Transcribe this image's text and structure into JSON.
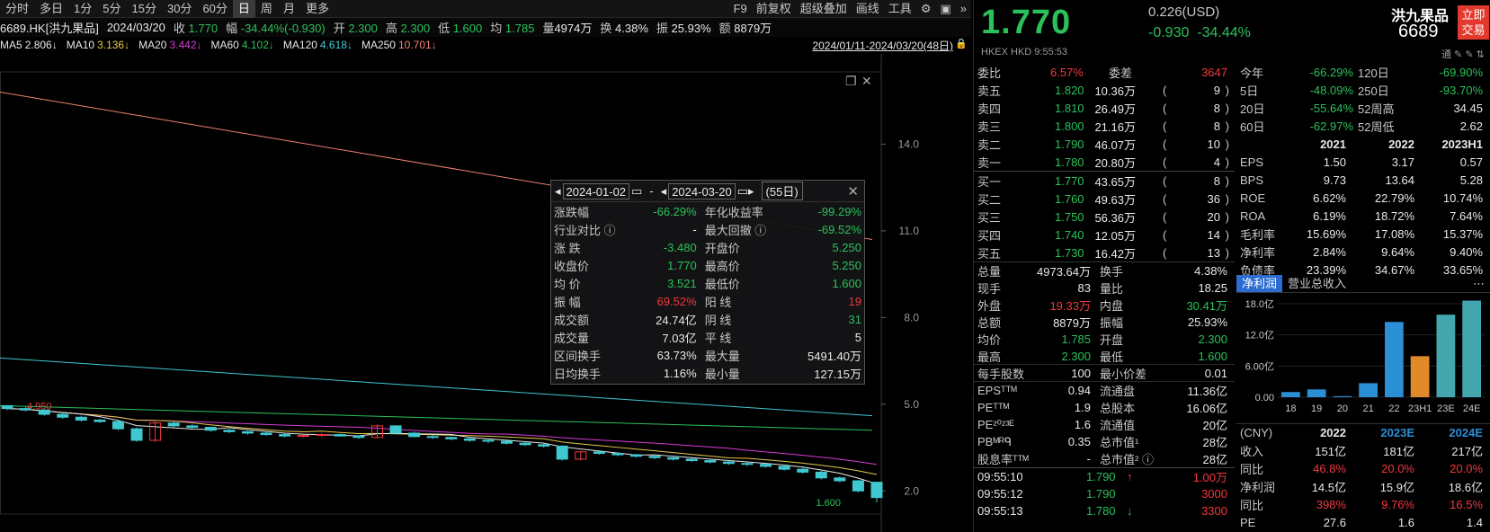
{
  "toolbar": {
    "periods": [
      "分时",
      "多日",
      "1分",
      "5分",
      "15分",
      "30分",
      "60分",
      "日",
      "周",
      "月",
      "更多"
    ],
    "active": "日",
    "right": [
      "F9",
      "前复权",
      "超级叠加",
      "画线",
      "工具"
    ]
  },
  "info": {
    "ticker": "6689.HK[洪九果品]",
    "date": "2024/03/20",
    "close_label": "收",
    "close": "1.770",
    "range_label": "幅",
    "range": "-34.44%(-0.930)",
    "open_label": "开",
    "open": "2.300",
    "high_label": "高",
    "high": "2.300",
    "low_label": "低",
    "low": "1.600",
    "avg_label": "均",
    "avg": "1.785",
    "vol_label": "量",
    "vol": "4974万",
    "turn_label": "换",
    "turn": "4.38%",
    "amp_label": "振",
    "amp": "25.93%",
    "amt_label": "额",
    "amt": "8879万"
  },
  "ma": [
    {
      "label": "MA5",
      "value": "2.806↓",
      "color": "#e8e8e8"
    },
    {
      "label": "MA10",
      "value": "3.136↓",
      "color": "#e6c84a"
    },
    {
      "label": "MA20",
      "value": "3.442↓",
      "color": "#d63bd6"
    },
    {
      "label": "MA60",
      "value": "4.102↓",
      "color": "#2bc15a"
    },
    {
      "label": "MA120",
      "value": "4.618↓",
      "color": "#3fc8d0"
    },
    {
      "label": "MA250",
      "value": "10.701↓",
      "color": "#f08070"
    }
  ],
  "range_label": "2024/01/11-2024/03/20(48日)",
  "chart_data": {
    "type": "candlestick",
    "y_ticks": [
      "14.0",
      "11.0",
      "8.0",
      "5.0",
      "2.0"
    ],
    "ylim": [
      1.2,
      16.5
    ],
    "last_label": "1.600",
    "left_label": "4.950",
    "candles": [
      [
        4.95,
        4.95,
        4.8,
        4.85
      ],
      [
        4.85,
        4.9,
        4.75,
        4.8
      ],
      [
        4.8,
        4.82,
        4.6,
        4.65
      ],
      [
        4.65,
        4.7,
        4.5,
        4.55
      ],
      [
        4.55,
        4.6,
        4.4,
        4.45
      ],
      [
        4.45,
        4.5,
        4.35,
        4.4
      ],
      [
        4.4,
        4.42,
        4.1,
        4.15
      ],
      [
        4.15,
        4.2,
        3.7,
        3.75
      ],
      [
        3.75,
        4.4,
        3.7,
        4.35
      ],
      [
        4.35,
        4.4,
        4.2,
        4.25
      ],
      [
        4.25,
        4.3,
        4.15,
        4.2
      ],
      [
        4.2,
        4.22,
        4.05,
        4.1
      ],
      [
        4.1,
        4.15,
        4.0,
        4.05
      ],
      [
        4.05,
        4.08,
        3.95,
        4.0
      ],
      [
        4.0,
        4.05,
        3.9,
        3.95
      ],
      [
        3.95,
        3.98,
        3.85,
        3.9
      ],
      [
        3.9,
        3.95,
        3.85,
        3.92
      ],
      [
        3.92,
        4.0,
        3.88,
        3.95
      ],
      [
        3.95,
        3.98,
        3.88,
        3.9
      ],
      [
        3.9,
        3.92,
        3.8,
        3.85
      ],
      [
        3.85,
        4.3,
        3.82,
        4.25
      ],
      [
        4.25,
        4.28,
        3.95,
        4.0
      ],
      [
        4.0,
        4.05,
        3.85,
        3.88
      ],
      [
        3.88,
        3.92,
        3.8,
        3.85
      ],
      [
        3.85,
        3.88,
        3.75,
        3.8
      ],
      [
        3.8,
        3.85,
        3.7,
        3.75
      ],
      [
        3.75,
        3.8,
        3.65,
        3.72
      ],
      [
        3.72,
        3.75,
        3.6,
        3.65
      ],
      [
        3.65,
        3.7,
        3.55,
        3.6
      ],
      [
        3.6,
        3.62,
        3.5,
        3.55
      ],
      [
        3.55,
        3.58,
        3.05,
        3.1
      ],
      [
        3.1,
        3.4,
        3.05,
        3.35
      ],
      [
        3.35,
        3.4,
        3.25,
        3.3
      ],
      [
        3.3,
        3.32,
        3.2,
        3.25
      ],
      [
        3.25,
        3.28,
        3.15,
        3.2
      ],
      [
        3.2,
        3.25,
        3.1,
        3.15
      ],
      [
        3.15,
        3.2,
        3.05,
        3.1
      ],
      [
        3.1,
        3.15,
        3.0,
        3.05
      ],
      [
        3.05,
        3.1,
        2.95,
        3.0
      ],
      [
        3.0,
        3.05,
        2.9,
        2.95
      ],
      [
        2.95,
        3.0,
        2.85,
        2.92
      ],
      [
        2.92,
        2.95,
        2.8,
        2.85
      ],
      [
        2.85,
        2.9,
        2.7,
        2.75
      ],
      [
        2.75,
        2.8,
        2.6,
        2.65
      ],
      [
        2.65,
        2.7,
        2.4,
        2.45
      ],
      [
        2.45,
        2.5,
        2.3,
        2.35
      ],
      [
        2.35,
        2.38,
        1.95,
        2.0
      ],
      [
        2.3,
        2.3,
        1.6,
        1.77
      ]
    ],
    "ma250_start": 15.8,
    "ma250_end": 10.7,
    "ma120_start": 6.6,
    "ma120_end": 4.6,
    "ma60_start": 4.95,
    "ma60_end": 4.1
  },
  "popup": {
    "from": "2024-01-02",
    "dash": "-",
    "to": "2024-03-20",
    "days": "(55日)",
    "rows": [
      [
        "涨跌幅",
        "-66.29%",
        "dn",
        "年化收益率",
        "-99.29%",
        "dn"
      ],
      [
        "行业对比 ⓘ",
        "-",
        "wh",
        "最大回撤 ⓘ",
        "-69.52%",
        "dn"
      ],
      [
        "涨  跌",
        "-3.480",
        "dn",
        "开盘价",
        "5.250",
        "dn"
      ],
      [
        "收盘价",
        "1.770",
        "dn",
        "最高价",
        "5.250",
        "dn"
      ],
      [
        "均  价",
        "3.521",
        "dn",
        "最低价",
        "1.600",
        "dn"
      ],
      [
        "振  幅",
        "69.52%",
        "up",
        "阳  线",
        "19",
        "up"
      ],
      [
        "成交额",
        "24.74亿",
        "wh",
        "阴  线",
        "31",
        "dn"
      ],
      [
        "成交量",
        "7.03亿",
        "wh",
        "平  线",
        "5",
        "wh"
      ],
      [
        "区间换手",
        "63.73%",
        "wh",
        "最大量",
        "5491.40万",
        "wh"
      ],
      [
        "日均换手",
        "1.16%",
        "wh",
        "最小量",
        "127.15万",
        "wh"
      ]
    ]
  },
  "quote": {
    "price": "1.770",
    "usd": "0.226(USD)",
    "chg": "-0.930",
    "pct": "-34.44%",
    "name": "洪九果品",
    "code": "6689",
    "trade_btn": "立即交易",
    "meta": "HKEX  HKD  9:55:53",
    "tools": "通 ✎ ✎ ⇅"
  },
  "orderbook": {
    "header": [
      "委比",
      "6.57%",
      "委差",
      "3647"
    ],
    "asks": [
      [
        "卖五",
        "1.820",
        "10.36万",
        "9"
      ],
      [
        "卖四",
        "1.810",
        "26.49万",
        "8"
      ],
      [
        "卖三",
        "1.800",
        "21.16万",
        "8"
      ],
      [
        "卖二",
        "1.790",
        "46.07万",
        "10"
      ],
      [
        "卖一",
        "1.780",
        "20.80万",
        "4"
      ]
    ],
    "bids": [
      [
        "买一",
        "1.770",
        "43.65万",
        "8"
      ],
      [
        "买二",
        "1.760",
        "49.63万",
        "36"
      ],
      [
        "买三",
        "1.750",
        "56.36万",
        "20"
      ],
      [
        "买四",
        "1.740",
        "12.05万",
        "14"
      ],
      [
        "买五",
        "1.730",
        "16.42万",
        "13"
      ]
    ]
  },
  "details": [
    [
      "总量",
      "4973.64万",
      "wh",
      "换手",
      "4.38%",
      "wh"
    ],
    [
      "现手",
      "83",
      "wh",
      "量比",
      "18.25",
      "wh"
    ],
    [
      "外盘",
      "19.33万",
      "up",
      "内盘",
      "30.41万",
      "dn"
    ],
    [
      "总额",
      "8879万",
      "wh",
      "振幅",
      "25.93%",
      "wh"
    ],
    [
      "均价",
      "1.785",
      "dn",
      "开盘",
      "2.300",
      "dn"
    ],
    [
      "最高",
      "2.300",
      "dn",
      "最低",
      "1.600",
      "dn"
    ],
    [
      "每手股数",
      "100",
      "wh",
      "最小价差",
      "0.01",
      "wh"
    ],
    [
      "EPSᵀᵀᴹ",
      "0.94",
      "wh",
      "流通盘",
      "11.36亿",
      "wh"
    ],
    [
      "PEᵀᵀᴹ",
      "1.9",
      "wh",
      "总股本",
      "16.06亿",
      "wh"
    ],
    [
      "PE²⁰²³ᴱ",
      "1.6",
      "wh",
      "流通值",
      "20亿",
      "wh"
    ],
    [
      "PBᴹᴿᑫ",
      "0.35",
      "wh",
      "总市值¹",
      "28亿",
      "wh"
    ],
    [
      "股息率ᵀᵀᴹ",
      "-",
      "wh",
      "总市值² ⓘ",
      "28亿",
      "wh"
    ]
  ],
  "ticks": [
    [
      "09:55:10",
      "1.790",
      "↑",
      "1.00万"
    ],
    [
      "09:55:12",
      "1.790",
      "",
      "3000"
    ],
    [
      "09:55:13",
      "1.780",
      "↓",
      "3300"
    ]
  ],
  "perf": [
    [
      "今年",
      "-66.29%",
      "120日",
      "-69.90%"
    ],
    [
      "5日",
      "-48.09%",
      "250日",
      "-93.70%"
    ],
    [
      "20日",
      "-55.64%",
      "52周高",
      "34.45"
    ],
    [
      "60日",
      "-62.97%",
      "52周低",
      "2.62"
    ]
  ],
  "fin": {
    "years": [
      "2021",
      "2022",
      "2023H1"
    ],
    "rows": [
      [
        "EPS",
        "1.50",
        "3.17",
        "0.57"
      ],
      [
        "BPS",
        "9.73",
        "13.64",
        "5.28"
      ],
      [
        "ROE",
        "6.62%",
        "22.79%",
        "10.74%"
      ],
      [
        "ROA",
        "6.19%",
        "18.72%",
        "7.64%"
      ],
      [
        "毛利率",
        "15.69%",
        "17.08%",
        "15.37%"
      ],
      [
        "净利率",
        "2.84%",
        "9.64%",
        "9.40%"
      ],
      [
        "负债率",
        "23.39%",
        "34.67%",
        "33.65%"
      ]
    ]
  },
  "profit": {
    "tabs": [
      "净利润",
      "营业总收入"
    ],
    "y_ticks": [
      "18.0亿",
      "12.0亿",
      "6.00亿",
      "0.00"
    ],
    "categories": [
      "18",
      "19",
      "20",
      "21",
      "22",
      "23H1",
      "23E",
      "24E"
    ],
    "values": [
      1.0,
      1.5,
      0.2,
      2.7,
      14.5,
      7.9,
      15.9,
      18.6
    ],
    "colors": [
      "#2b8fd6",
      "#2b8fd6",
      "#2b8fd6",
      "#2b8fd6",
      "#2b8fd6",
      "#e08a2a",
      "#44a6ae",
      "#44a6ae"
    ]
  },
  "forecast": {
    "header": [
      "(CNY)",
      "2022",
      "2023E",
      "2024E"
    ],
    "rows": [
      [
        "收入",
        "151亿",
        "181亿",
        "217亿"
      ],
      [
        "同比",
        "46.8%",
        "20.0%",
        "20.0%"
      ],
      [
        "净利润",
        "14.5亿",
        "15.9亿",
        "18.6亿"
      ],
      [
        "同比",
        "398%",
        "9.76%",
        "16.5%"
      ],
      [
        "PE",
        "27.6",
        "1.6",
        "1.4"
      ]
    ]
  }
}
